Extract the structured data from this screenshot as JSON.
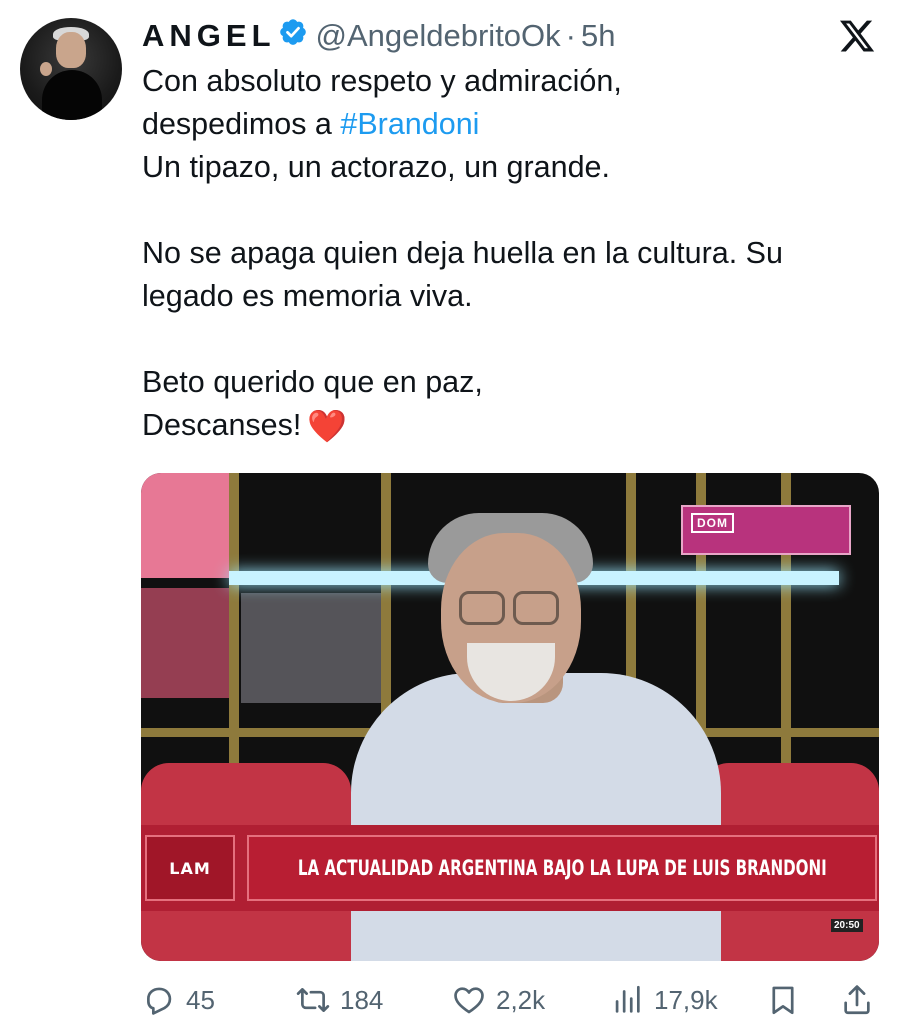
{
  "author": {
    "display_name": "ANGEL",
    "handle": "@AngeldebritoOk",
    "separator": "·",
    "time": "5h"
  },
  "tweet": {
    "lines": [
      "Con absoluto respeto y admiración,",
      "despedimos a ",
      "Un tipazo, un actorazo, un grande.",
      "No se apaga quien deja huella en la cultura. Su",
      "legado es memoria viva.",
      "Beto querido que en paz,",
      "Descanses!"
    ],
    "hashtag": "#Brandoni",
    "emoji": "❤️"
  },
  "media": {
    "tv_logo": "DOM",
    "channel_bug": "LAM",
    "caption": "LA ACTUALIDAD ARGENTINA BAJO LA LUPA DE LUIS BRANDONI",
    "clock": "20:50"
  },
  "actions": {
    "replies": "45",
    "reposts": "184",
    "likes": "2,2k",
    "views": "17,9k"
  },
  "icons": [
    "verified-icon",
    "x-logo-icon",
    "reply-icon",
    "repost-icon",
    "like-icon",
    "views-icon",
    "bookmark-icon",
    "share-icon"
  ],
  "colors": {
    "text": "#0f1419",
    "secondary": "#536471",
    "link": "#1d9bf0",
    "verified": "#1d9bf0"
  }
}
